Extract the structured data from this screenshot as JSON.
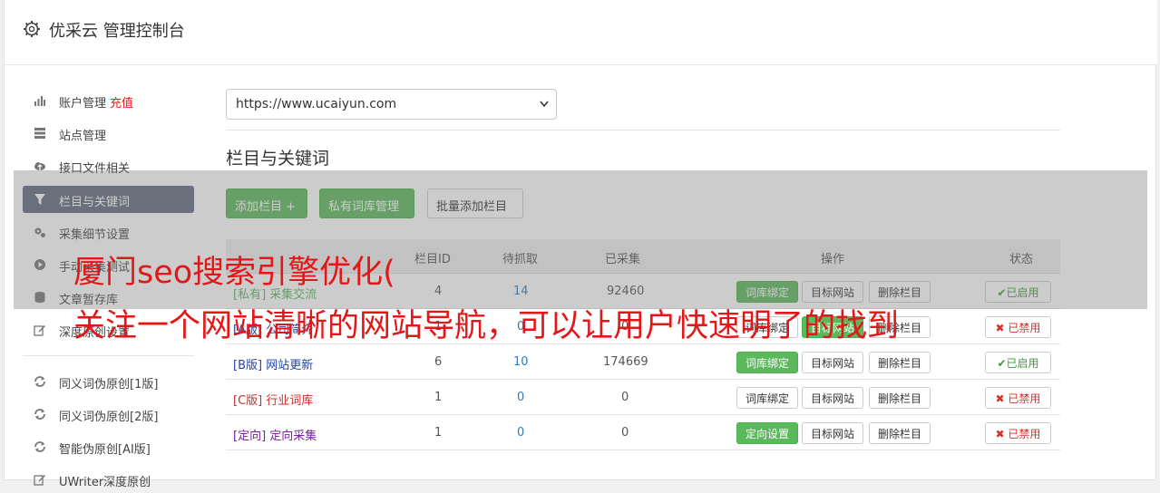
{
  "header": {
    "title": "优采云 管理控制台",
    "icon": "gear-icon"
  },
  "sidebar": {
    "items": [
      {
        "label": "账户管理",
        "extra": "充值",
        "icon": "bar-chart-icon"
      },
      {
        "label": "站点管理",
        "icon": "server-icon"
      },
      {
        "label": "接口文件相关",
        "icon": "cloud-upload-icon"
      },
      {
        "label": "栏目与关键词",
        "icon": "filter-icon",
        "active": true
      },
      {
        "label": "采集细节设置",
        "icon": "cogs-icon"
      },
      {
        "label": "手动采集测试",
        "icon": "play-circle-icon"
      },
      {
        "label": "文章暂存库",
        "icon": "database-icon"
      },
      {
        "label": "深度原创设置",
        "icon": "edit-icon"
      }
    ],
    "tools": [
      {
        "label": "同义词伪原创[1版]",
        "icon": "refresh-icon"
      },
      {
        "label": "同义词伪原创[2版]",
        "icon": "refresh-icon"
      },
      {
        "label": "智能伪原创[AI版]",
        "icon": "refresh-icon"
      },
      {
        "label": "UWriter深度原创",
        "icon": "edit-icon"
      }
    ]
  },
  "site_select": {
    "value": "https://www.ucaiyun.com"
  },
  "section": {
    "title": "栏目与关键词"
  },
  "toolbar": {
    "add_label": "添加栏目 +",
    "private_lib_label": "私有词库管理",
    "batch_add_label": "批量添加栏目"
  },
  "table": {
    "headers": {
      "id": "栏目ID",
      "pending": "待抓取",
      "collected": "已采集",
      "ops": "操作",
      "status": "状态"
    },
    "rows": [
      {
        "tag": "[私有]",
        "name": "采集交流",
        "id": "4",
        "pending": "14",
        "collected": "92460",
        "bind": "词库绑定",
        "bind_active": true,
        "target": "目标网站",
        "delete": "删除栏目",
        "status": "已启用",
        "enabled": true,
        "color": "green"
      },
      {
        "tag": "[A版]",
        "name": "公司简介",
        "id": "1",
        "pending": "0",
        "collected": "0",
        "bind": "词库绑定",
        "bind_active": false,
        "target": "目标网站",
        "delete": "删除栏目",
        "status": "已禁用",
        "enabled": false,
        "color": "blue"
      },
      {
        "tag": "[B版]",
        "name": "网站更新",
        "id": "6",
        "pending": "10",
        "collected": "174669",
        "bind": "词库绑定",
        "bind_active": true,
        "target": "目标网站",
        "delete": "删除栏目",
        "status": "已启用",
        "enabled": true,
        "color": "blue"
      },
      {
        "tag": "[C版]",
        "name": "行业词库",
        "id": "1",
        "pending": "0",
        "collected": "0",
        "bind": "词库绑定",
        "bind_active": false,
        "target": "目标网站",
        "delete": "删除栏目",
        "status": "已禁用",
        "enabled": false,
        "color": "red"
      },
      {
        "tag": "[定向]",
        "name": "定向采集",
        "id": "1",
        "pending": "0",
        "collected": "0",
        "bind": "定向设置",
        "bind_active": true,
        "target": "目标网站",
        "delete": "删除栏目",
        "status": "已禁用",
        "enabled": false,
        "color": "purple"
      }
    ]
  },
  "overlay": {
    "line1": "厦门seo搜索引擎优化(",
    "line2": "关注一个网站清晰的网站导航，可以让用户快速明了的找到"
  },
  "colors": {
    "accent_green": "#5cb85c",
    "active_nav": "#5f6b7c",
    "overlay_text": "#e21818"
  }
}
